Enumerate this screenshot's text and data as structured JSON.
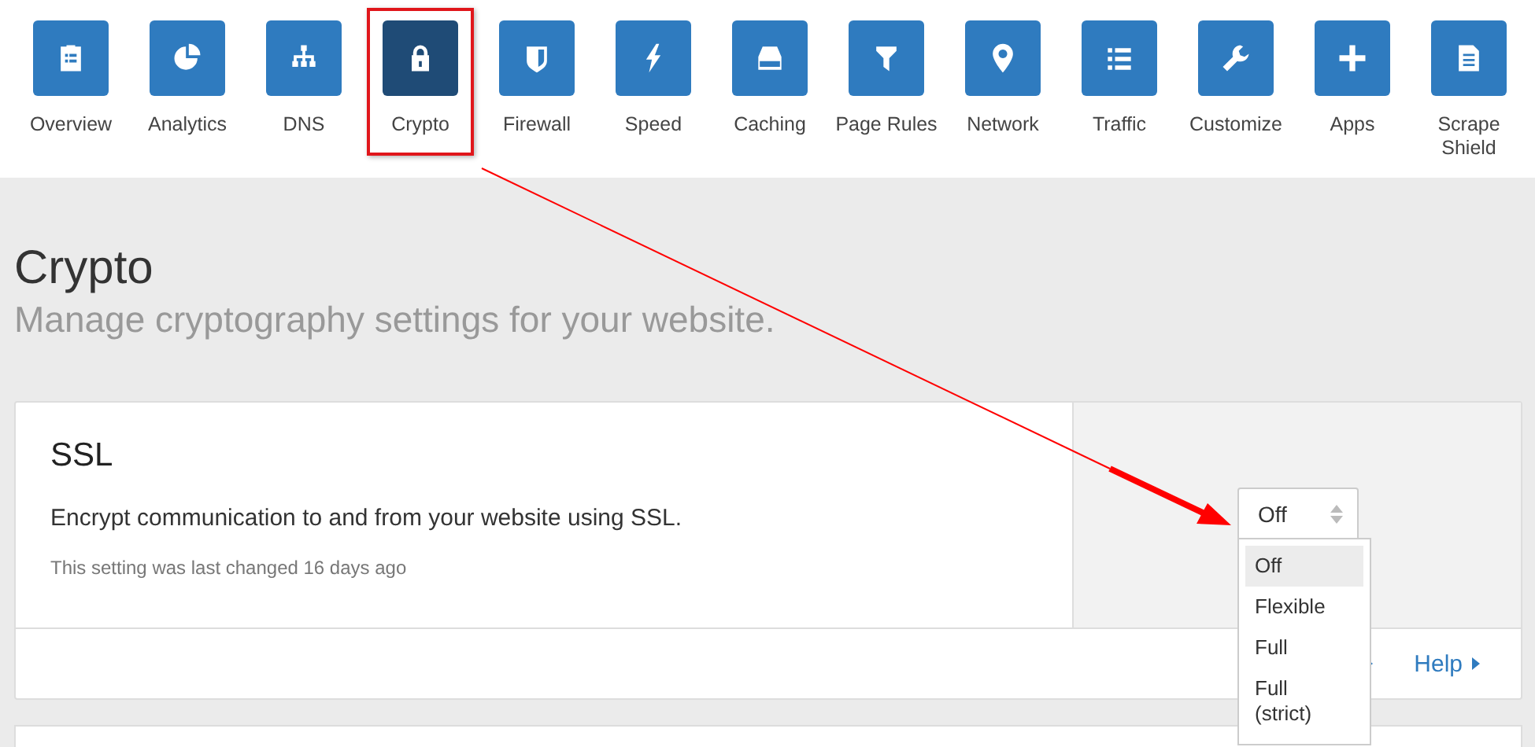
{
  "nav": [
    {
      "label": "Overview",
      "selected": false
    },
    {
      "label": "Analytics",
      "selected": false
    },
    {
      "label": "DNS",
      "selected": false
    },
    {
      "label": "Crypto",
      "selected": true
    },
    {
      "label": "Firewall",
      "selected": false
    },
    {
      "label": "Speed",
      "selected": false
    },
    {
      "label": "Caching",
      "selected": false
    },
    {
      "label": "Page Rules",
      "selected": false
    },
    {
      "label": "Network",
      "selected": false
    },
    {
      "label": "Traffic",
      "selected": false
    },
    {
      "label": "Customize",
      "selected": false
    },
    {
      "label": "Apps",
      "selected": false
    },
    {
      "label": "Scrape Shield",
      "selected": false
    }
  ],
  "page": {
    "title": "Crypto",
    "subtitle": "Manage cryptography settings for your website."
  },
  "card": {
    "title": "SSL",
    "description": "Encrypt communication to and from your website using SSL.",
    "last_changed": "This setting was last changed 16 days ago",
    "select": {
      "value": "Off",
      "options": [
        {
          "label": "Off",
          "selected": true
        },
        {
          "label": "Flexible",
          "selected": false
        },
        {
          "label": "Full",
          "selected": false
        },
        {
          "label": "Full (strict)",
          "selected": false
        }
      ]
    },
    "help_link": "Help"
  }
}
